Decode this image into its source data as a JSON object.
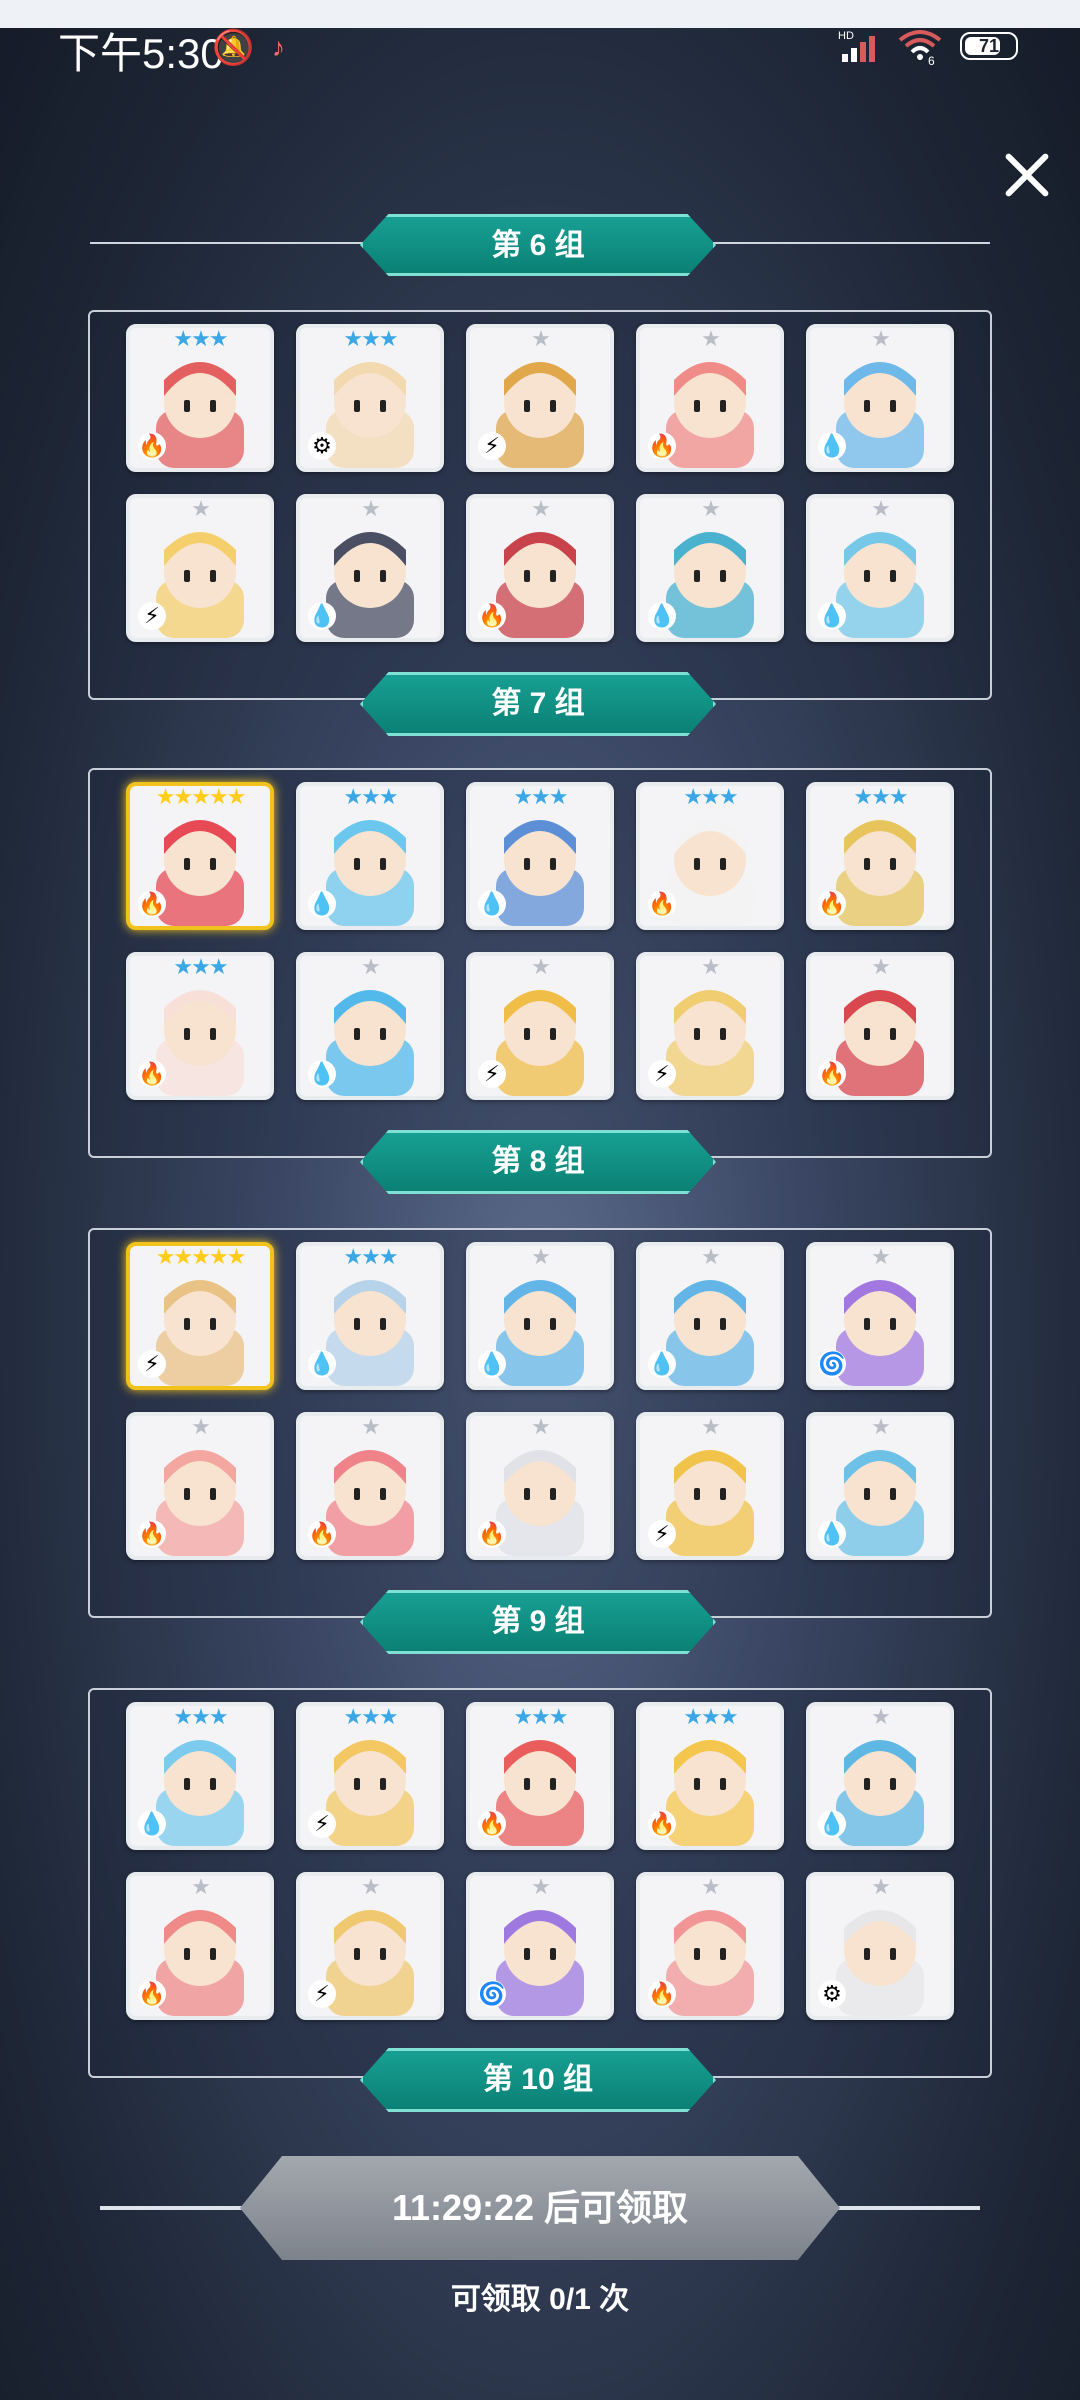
{
  "status_bar": {
    "time": "下午5:30",
    "mute_icon": "bell-off-icon",
    "tiktok_icon": "♪",
    "signal_label": "HD",
    "wifi_label": "6",
    "battery": "71"
  },
  "close_icon": "close-icon",
  "groups": [
    {
      "label": "第 6 组",
      "cards": [
        {
          "stars": "★★★",
          "star_color": "blue",
          "element": "fire",
          "face": "#e46060"
        },
        {
          "stars": "★★★",
          "star_color": "blue",
          "element": "gear",
          "face": "#f3d9b0"
        },
        {
          "stars": "★",
          "star_color": "silver",
          "element": "bolt",
          "face": "#e0a74b"
        },
        {
          "stars": "★",
          "star_color": "silver",
          "element": "fire",
          "face": "#f08c88"
        },
        {
          "stars": "★",
          "star_color": "silver",
          "element": "water",
          "face": "#6eb8ea"
        },
        {
          "stars": "★",
          "star_color": "silver",
          "element": "bolt",
          "face": "#f6cf6d"
        },
        {
          "stars": "★",
          "star_color": "silver",
          "element": "water",
          "face": "#4a4f63"
        },
        {
          "stars": "★",
          "star_color": "silver",
          "element": "fire",
          "face": "#c9434a"
        },
        {
          "stars": "★",
          "star_color": "silver",
          "element": "water",
          "face": "#4ab2cf"
        },
        {
          "stars": "★",
          "star_color": "silver",
          "element": "water",
          "face": "#75c8e8"
        }
      ]
    },
    {
      "label": "第 7 组",
      "cards": [
        {
          "stars": "★★★★★",
          "star_color": "gold",
          "element": "fire",
          "face": "#e74a55",
          "gold": true
        },
        {
          "stars": "★★★",
          "star_color": "blue",
          "element": "water",
          "face": "#6cc7ee"
        },
        {
          "stars": "★★★",
          "star_color": "blue",
          "element": "water",
          "face": "#5c8fd6"
        },
        {
          "stars": "★★★",
          "star_color": "blue",
          "element": "fire",
          "face": "#f3f3f3"
        },
        {
          "stars": "★★★",
          "star_color": "blue",
          "element": "fire",
          "face": "#e7c45c"
        },
        {
          "stars": "★★★",
          "star_color": "blue",
          "element": "fire",
          "face": "#f8e0d9"
        },
        {
          "stars": "★",
          "star_color": "silver",
          "element": "water",
          "face": "#52b9ea"
        },
        {
          "stars": "★",
          "star_color": "silver",
          "element": "bolt",
          "face": "#f0bd47"
        },
        {
          "stars": "★",
          "star_color": "silver",
          "element": "bolt",
          "face": "#f1cd72"
        },
        {
          "stars": "★",
          "star_color": "silver",
          "element": "fire",
          "face": "#d9474f"
        }
      ]
    },
    {
      "label": "第 8 组",
      "cards": [
        {
          "stars": "★★★★★",
          "star_color": "gold",
          "element": "bolt",
          "face": "#e9c285",
          "gold": true
        },
        {
          "stars": "★★★",
          "star_color": "blue",
          "element": "water",
          "face": "#b6d3ea"
        },
        {
          "stars": "★",
          "star_color": "silver",
          "element": "water",
          "face": "#63b5e7"
        },
        {
          "stars": "★",
          "star_color": "silver",
          "element": "water",
          "face": "#63b5e7"
        },
        {
          "stars": "★",
          "star_color": "silver",
          "element": "dark",
          "face": "#a278e0"
        },
        {
          "stars": "★",
          "star_color": "silver",
          "element": "fire",
          "face": "#f4a6a0"
        },
        {
          "stars": "★",
          "star_color": "silver",
          "element": "fire",
          "face": "#f0838a"
        },
        {
          "stars": "★",
          "star_color": "silver",
          "element": "fire",
          "face": "#e0e2e8"
        },
        {
          "stars": "★",
          "star_color": "silver",
          "element": "bolt",
          "face": "#f1c34a"
        },
        {
          "stars": "★",
          "star_color": "silver",
          "element": "water",
          "face": "#6ec1e6"
        }
      ]
    },
    {
      "label": "第 9 组",
      "cards": [
        {
          "stars": "★★★",
          "star_color": "blue",
          "element": "water",
          "face": "#7ccbee"
        },
        {
          "stars": "★★★",
          "star_color": "blue",
          "element": "bolt",
          "face": "#f3c863"
        },
        {
          "stars": "★★★",
          "star_color": "blue",
          "element": "fire",
          "face": "#e95d5d"
        },
        {
          "stars": "★★★",
          "star_color": "blue",
          "element": "fire",
          "face": "#f5c64d"
        },
        {
          "stars": "★",
          "star_color": "silver",
          "element": "water",
          "face": "#5fb7e3"
        },
        {
          "stars": "★",
          "star_color": "silver",
          "element": "fire",
          "face": "#f08a88"
        },
        {
          "stars": "★",
          "star_color": "silver",
          "element": "bolt",
          "face": "#efc86f"
        },
        {
          "stars": "★",
          "star_color": "silver",
          "element": "dark",
          "face": "#9e7ae0"
        },
        {
          "stars": "★",
          "star_color": "silver",
          "element": "fire",
          "face": "#f29596"
        },
        {
          "stars": "★",
          "star_color": "silver",
          "element": "gear",
          "face": "#e7e7ea"
        }
      ]
    }
  ],
  "final_label": "第 10 组",
  "claim": {
    "button_label": "11:29:22 后可领取",
    "count_label": "可领取 0/1 次"
  },
  "element_glyphs": {
    "fire": "🔥",
    "water": "💧",
    "bolt": "⚡",
    "gear": "⚙",
    "dark": "🌀"
  },
  "colors": {
    "teal": "#0f8f82",
    "panel_border": "#c8cfd8",
    "gold": "#f2c21c"
  }
}
